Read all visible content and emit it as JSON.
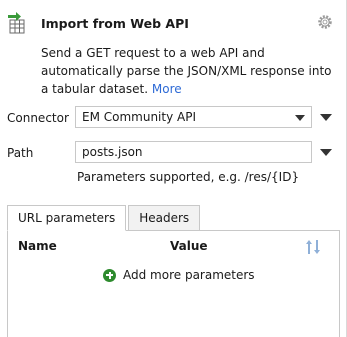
{
  "header": {
    "title": "Import from Web API",
    "description": "Send a GET request to a web API and automatically parse the JSON/XML response into a tabular dataset.",
    "more_link": "More",
    "icons": {
      "node": "import-web-api-icon",
      "settings": "gear-icon"
    }
  },
  "connector": {
    "label": "Connector",
    "value": "EM Community API"
  },
  "path": {
    "label": "Path",
    "value": "posts.json",
    "hint": "Parameters supported, e.g. /res/{ID}"
  },
  "tabs": [
    {
      "label": "URL parameters",
      "active": true
    },
    {
      "label": "Headers",
      "active": false
    }
  ],
  "table": {
    "columns": {
      "name": "Name",
      "value": "Value"
    },
    "add_label": "Add more parameters"
  },
  "colors": {
    "link": "#2f6bd6",
    "add": "#2e8b2e",
    "icon_green": "#3a9a3a"
  }
}
